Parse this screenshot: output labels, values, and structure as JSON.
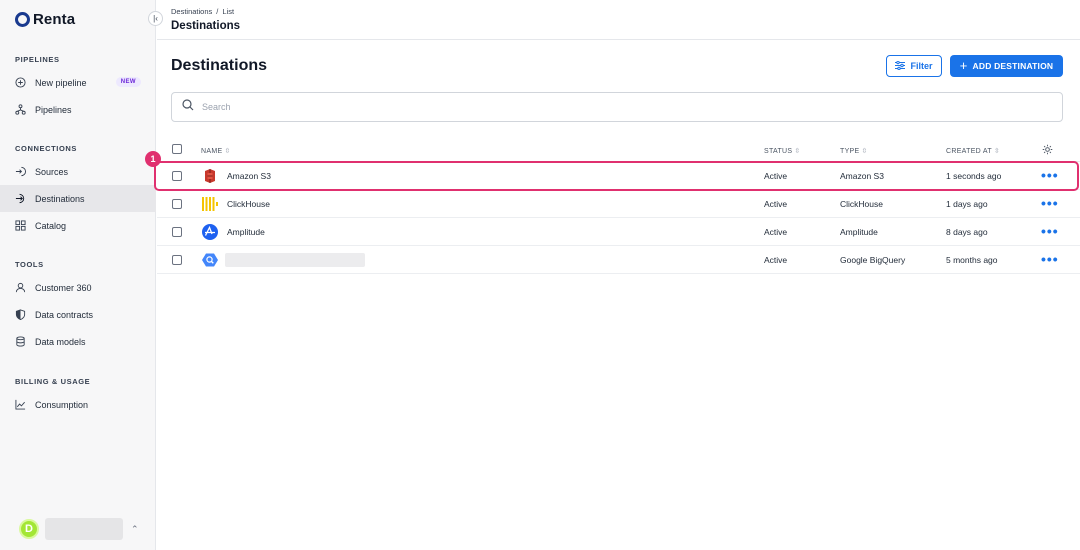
{
  "app": {
    "name": "Renta"
  },
  "sidebar": {
    "sections": [
      {
        "title": "PIPELINES",
        "items": [
          {
            "label": "New pipeline",
            "icon": "plus-circle-icon",
            "badge": "NEW"
          },
          {
            "label": "Pipelines",
            "icon": "pipelines-icon"
          }
        ]
      },
      {
        "title": "CONNECTIONS",
        "items": [
          {
            "label": "Sources",
            "icon": "sources-icon"
          },
          {
            "label": "Destinations",
            "icon": "destinations-icon",
            "active": true
          },
          {
            "label": "Catalog",
            "icon": "catalog-icon"
          }
        ]
      },
      {
        "title": "TOOLS",
        "items": [
          {
            "label": "Customer 360",
            "icon": "user-icon"
          },
          {
            "label": "Data contracts",
            "icon": "shield-icon"
          },
          {
            "label": "Data models",
            "icon": "database-icon"
          }
        ]
      },
      {
        "title": "BILLING & USAGE",
        "items": [
          {
            "label": "Consumption",
            "icon": "chart-line-icon"
          }
        ]
      }
    ],
    "user": {
      "initial": "D"
    }
  },
  "header": {
    "breadcrumb": [
      "Destinations",
      "List"
    ],
    "breadcrumb_sep": "/",
    "title": "Destinations"
  },
  "main": {
    "title": "Destinations",
    "filter_label": "Filter",
    "add_label": "ADD DESTINATION",
    "search_placeholder": "Search"
  },
  "table": {
    "columns": {
      "name": "NAME",
      "status": "STATUS",
      "type": "TYPE",
      "created": "CREATED AT"
    },
    "rows": [
      {
        "name": "Amazon S3",
        "status": "Active",
        "type": "Amazon S3",
        "created": "1 seconds ago",
        "icon": "amazon-s3-icon"
      },
      {
        "name": "ClickHouse",
        "status": "Active",
        "type": "ClickHouse",
        "created": "1 days ago",
        "icon": "clickhouse-icon"
      },
      {
        "name": "Amplitude",
        "status": "Active",
        "type": "Amplitude",
        "created": "8 days ago",
        "icon": "amplitude-icon"
      },
      {
        "name": "",
        "status": "Active",
        "type": "Google BigQuery",
        "created": "5 months ago",
        "icon": "bigquery-icon"
      }
    ],
    "more_label": "•••"
  },
  "annotation": {
    "marker": "1"
  },
  "colors": {
    "accent": "#1a73e8",
    "highlight": "#e0306f",
    "brand": "#1a3a8f"
  }
}
